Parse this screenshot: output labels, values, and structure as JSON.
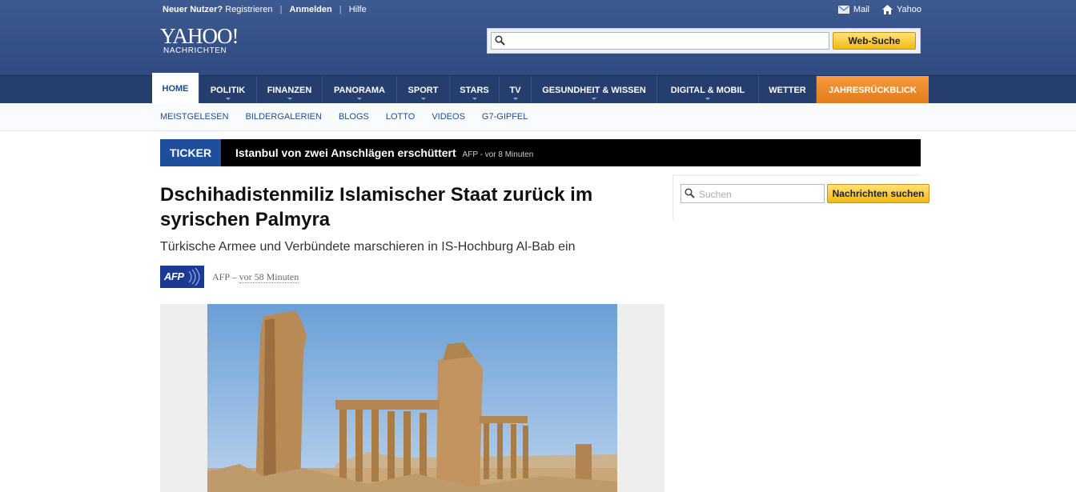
{
  "topbar": {
    "new_user": "Neuer Nutzer?",
    "register": "Registrieren",
    "login": "Anmelden",
    "help": "Hilfe",
    "mail": "Mail",
    "yahoo": "Yahoo"
  },
  "logo": {
    "brand": "YAHOO!",
    "section": "NACHRICHTEN"
  },
  "search": {
    "value": "",
    "placeholder": "",
    "button": "Web-Suche"
  },
  "nav": {
    "items": [
      {
        "label": "HOME"
      },
      {
        "label": "POLITIK"
      },
      {
        "label": "FINANZEN"
      },
      {
        "label": "PANORAMA"
      },
      {
        "label": "SPORT"
      },
      {
        "label": "STARS"
      },
      {
        "label": "TV"
      },
      {
        "label": "GESUNDHEIT & WISSEN"
      },
      {
        "label": "DIGITAL & MOBIL"
      },
      {
        "label": "WETTER"
      },
      {
        "label": "JAHRESRÜCKBLICK"
      }
    ]
  },
  "subnav": {
    "items": [
      {
        "label": "MEISTGELESEN"
      },
      {
        "label": "BILDERGALERIEN"
      },
      {
        "label": "BLOGS"
      },
      {
        "label": "LOTTO"
      },
      {
        "label": "VIDEOS"
      },
      {
        "label": "G7-GIPFEL"
      }
    ]
  },
  "ticker": {
    "label": "TICKER",
    "headline": "Istanbul von zwei Anschlägen erschüttert",
    "meta": "AFP - vor 8 Minuten"
  },
  "article": {
    "title": "Dschihadistenmiliz Islamischer Staat zurück im syrischen Palmyra",
    "subtitle": "Türkische Armee und Verbündete marschieren in IS-Hochburg Al-Bab ein",
    "source_logo": "AFP",
    "source": "AFP –",
    "time": "vor 58 Minuten"
  },
  "news_search": {
    "placeholder": "Suchen",
    "button": "Nachrichten suchen"
  },
  "colors": {
    "header_bg": "#34508a",
    "nav_bg": "#253e6e",
    "accent_orange": "#e8892a",
    "ticker_blue": "#1f4f9c",
    "button_yellow": "#f6c631"
  }
}
